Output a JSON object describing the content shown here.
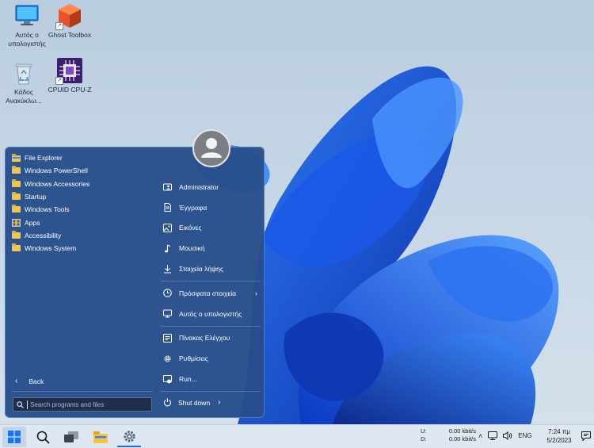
{
  "desktop": {
    "icons": [
      {
        "label": "Αυτός ο υπολογιστής"
      },
      {
        "label": "Ghost Toolbox"
      },
      {
        "label": "Κάδος Ανακύκλω..."
      },
      {
        "label": "CPUID CPU-Z"
      }
    ]
  },
  "start_menu": {
    "programs": [
      {
        "label": "File Explorer"
      },
      {
        "label": "Windows PowerShell"
      },
      {
        "label": "Windows Accessories"
      },
      {
        "label": "Startup"
      },
      {
        "label": "Windows Tools"
      },
      {
        "label": "Apps"
      },
      {
        "label": "Accessibility"
      },
      {
        "label": "Windows System"
      }
    ],
    "places": [
      {
        "label": "Administrator",
        "icon": "user-folder-icon"
      },
      {
        "label": "Έγγραφα",
        "icon": "document-icon"
      },
      {
        "label": "Εικόνες",
        "icon": "picture-icon"
      },
      {
        "label": "Μουσική",
        "icon": "music-note-icon"
      },
      {
        "label": "Στοιχεία λήψης",
        "icon": "download-icon"
      },
      {
        "label": "Πρόσφατα στοιχεία",
        "icon": "clock-icon"
      },
      {
        "label": "Αυτός ο υπολογιστής",
        "icon": "monitor-icon"
      },
      {
        "label": "Πίνακας Ελέγχου",
        "icon": "control-panel-icon"
      },
      {
        "label": "Ρυθμίσεις",
        "icon": "gear-icon"
      },
      {
        "label": "Run...",
        "icon": "run-icon"
      }
    ],
    "back_label": "Back",
    "search_placeholder": "Search programs and files",
    "shutdown_label": "Shut down"
  },
  "taskbar": {
    "net": {
      "up_label": "U:",
      "up_value": "0.00 kbit/s",
      "down_label": "D:",
      "down_value": "0.00 kbit/s"
    },
    "language": "ENG",
    "time": "7:24 πμ",
    "date": "5/2/2023"
  },
  "colors": {
    "accent": "#1f6fe0",
    "start_menu_bg": "#264e8a",
    "taskbar_bg": "#dfe7f1"
  }
}
